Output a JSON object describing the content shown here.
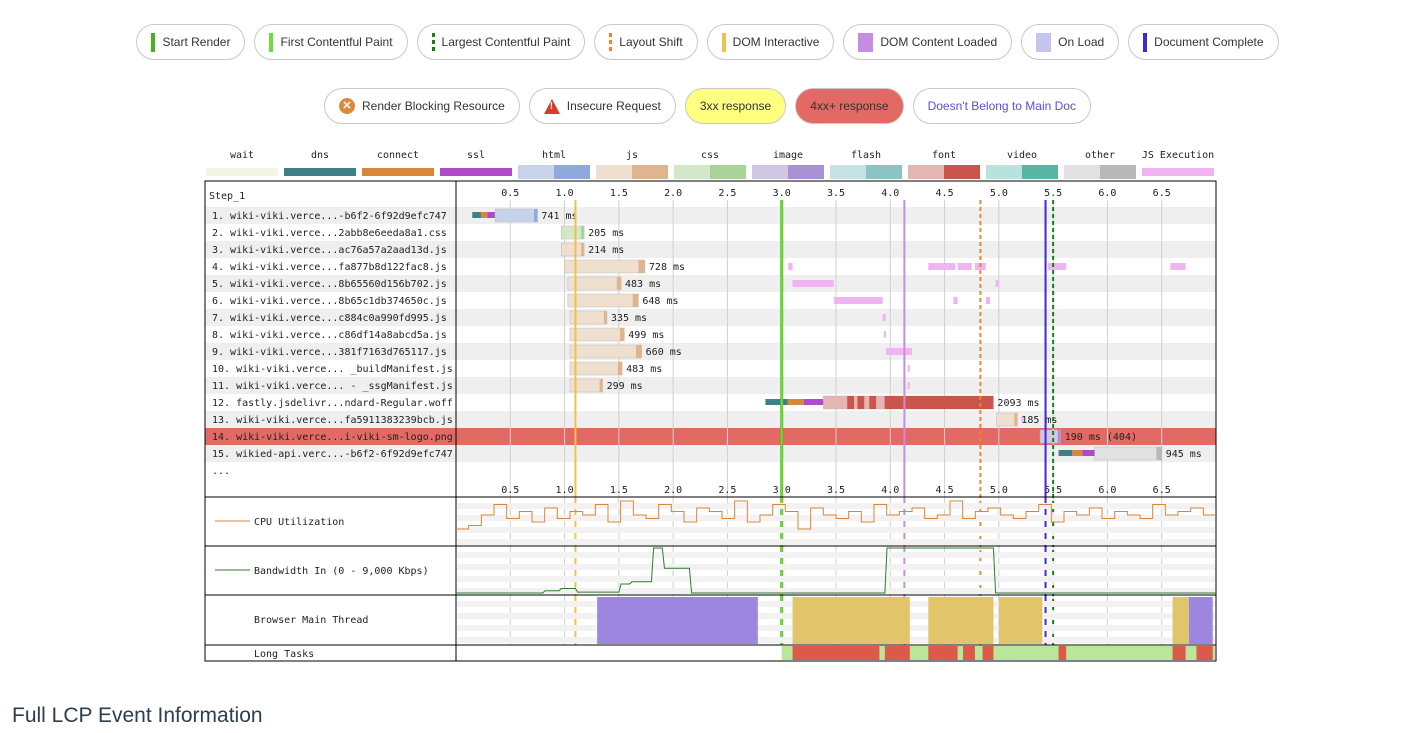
{
  "legend_top": [
    {
      "label": "Start Render",
      "kind": "bar",
      "color": "#4caf1f"
    },
    {
      "label": "First Contentful Paint",
      "kind": "bar",
      "color": "#6fdc3c"
    },
    {
      "label": "Largest Contentful Paint",
      "kind": "dash",
      "color": "#1b7d12"
    },
    {
      "label": "Layout Shift",
      "kind": "dash",
      "color": "#e38a2a"
    },
    {
      "label": "DOM Interactive",
      "kind": "bar",
      "color": "#f0c14b"
    },
    {
      "label": "DOM Content Loaded",
      "kind": "block",
      "color": "#c68ee0"
    },
    {
      "label": "On Load",
      "kind": "block",
      "color": "#c5c5f2"
    },
    {
      "label": "Document Complete",
      "kind": "bar",
      "color": "#3b2ad6"
    }
  ],
  "legend_bottom": [
    {
      "label": "Render Blocking Resource",
      "icon": "render-blocking-icon"
    },
    {
      "label": "Insecure Request",
      "icon": "warning-icon"
    },
    {
      "label": "3xx response",
      "style": "yellow"
    },
    {
      "label": "4xx+ response",
      "style": "red"
    },
    {
      "label": "Doesn't Belong to Main Doc",
      "style": "link"
    }
  ],
  "request_types": [
    {
      "label": "wait",
      "colors": [
        "#f5f5e6",
        "#f5f5e6"
      ]
    },
    {
      "label": "dns",
      "colors": [
        "#3f7f8a",
        "#3f7f8a"
      ]
    },
    {
      "label": "connect",
      "colors": [
        "#d7863a",
        "#d7863a"
      ]
    },
    {
      "label": "ssl",
      "colors": [
        "#b04bc7",
        "#b04bc7"
      ]
    },
    {
      "label": "html",
      "colors": [
        "#c7d3ea",
        "#8eaadc"
      ]
    },
    {
      "label": "js",
      "colors": [
        "#eedfcf",
        "#e0b58d"
      ]
    },
    {
      "label": "css",
      "colors": [
        "#d2e8c9",
        "#a8d49a"
      ]
    },
    {
      "label": "image",
      "colors": [
        "#cfc7e4",
        "#a991d6"
      ]
    },
    {
      "label": "flash",
      "colors": [
        "#c7e2e2",
        "#8cc3c3"
      ]
    },
    {
      "label": "font",
      "colors": [
        "#e3b6b1",
        "#c9554c"
      ]
    },
    {
      "label": "video",
      "colors": [
        "#b8e3dc",
        "#58b5a3"
      ]
    },
    {
      "label": "other",
      "colors": [
        "#e2e2e2",
        "#b8b8b8"
      ]
    },
    {
      "label": "JS Execution",
      "colors": [
        "#f1b4f2",
        "#f1b4f2"
      ]
    }
  ],
  "chart_data": {
    "type": "waterfall",
    "step_label": "Step_1",
    "x_unit": "seconds",
    "x_range": [
      0,
      7.0
    ],
    "ticks": [
      "0.5",
      "1.0",
      "1.5",
      "2.0",
      "2.5",
      "3.0",
      "3.5",
      "4.0",
      "4.5",
      "5.0",
      "5.5",
      "6.0",
      "6.5"
    ],
    "markers": [
      {
        "name": "DOM Interactive",
        "time": 1.1,
        "color": "#f0c14b",
        "style": "solid"
      },
      {
        "name": "Start Render",
        "time": 3.0,
        "color": "#4caf1f",
        "style": "solid"
      },
      {
        "name": "First Contentful Paint",
        "time": 3.0,
        "color": "#6fdc3c",
        "style": "solid"
      },
      {
        "name": "DOM Content Loaded",
        "time": 4.13,
        "color": "#c68ee0",
        "style": "solid"
      },
      {
        "name": "Layout Shift",
        "time": 4.83,
        "color": "#e38a2a",
        "style": "dashed"
      },
      {
        "name": "Document Complete",
        "time": 5.43,
        "color": "#3b2ad6",
        "style": "solid"
      },
      {
        "name": "Largest Contentful Paint",
        "time": 5.5,
        "color": "#1b7d12",
        "style": "dashed"
      }
    ],
    "requests": [
      {
        "num": "1.",
        "url": "wiki-viki.verce...-b6f2-6f92d9efc747",
        "type": "html",
        "start": 0.15,
        "end": 0.75,
        "label": "741 ms",
        "highlight": false,
        "js": []
      },
      {
        "num": "2.",
        "url": "wiki-viki.verce...2abb8e6eeda8a1.css",
        "type": "css",
        "start": 0.97,
        "end": 1.18,
        "label": "205 ms",
        "highlight": false,
        "js": []
      },
      {
        "num": "3.",
        "url": "wiki-viki.verce...ac76a57a2aad13d.js",
        "type": "js",
        "start": 0.97,
        "end": 1.18,
        "label": "214 ms",
        "highlight": false,
        "js": []
      },
      {
        "num": "4.",
        "url": "wiki-viki.verce...fa877b8d122fac8.js",
        "type": "js",
        "start": 1.0,
        "end": 1.74,
        "label": "728 ms",
        "highlight": false,
        "js": [
          [
            3.06,
            3.1
          ],
          [
            4.35,
            4.6
          ],
          [
            4.62,
            4.75
          ],
          [
            4.78,
            4.88
          ],
          [
            5.45,
            5.62
          ],
          [
            6.58,
            6.72
          ]
        ]
      },
      {
        "num": "5.",
        "url": "wiki-viki.verce...8b65560d156b702.js",
        "type": "js",
        "start": 1.03,
        "end": 1.52,
        "label": "483 ms",
        "highlight": false,
        "js": [
          [
            3.1,
            3.48
          ],
          [
            4.97,
            5.0
          ]
        ]
      },
      {
        "num": "6.",
        "url": "wiki-viki.verce...8b65c1db374650c.js",
        "type": "js",
        "start": 1.03,
        "end": 1.68,
        "label": "648 ms",
        "highlight": false,
        "js": [
          [
            3.48,
            3.93
          ],
          [
            4.58,
            4.62
          ],
          [
            4.88,
            4.92
          ]
        ]
      },
      {
        "num": "7.",
        "url": "wiki-viki.verce...c884c0a990fd995.js",
        "type": "js",
        "start": 1.05,
        "end": 1.39,
        "label": "335 ms",
        "highlight": false,
        "js": [
          [
            3.93,
            3.96
          ]
        ]
      },
      {
        "num": "8.",
        "url": "wiki-viki.verce...c86df14a8abcd5a.js",
        "type": "js",
        "start": 1.05,
        "end": 1.55,
        "label": "499 ms",
        "highlight": false,
        "js": [
          [
            3.94,
            3.96
          ]
        ]
      },
      {
        "num": "9.",
        "url": "wiki-viki.verce...381f7163d765117.js",
        "type": "js",
        "start": 1.05,
        "end": 1.71,
        "label": "660 ms",
        "highlight": false,
        "js": [
          [
            3.96,
            4.2
          ]
        ]
      },
      {
        "num": "10.",
        "url": "wiki-viki.verce... _buildManifest.js",
        "type": "js",
        "start": 1.05,
        "end": 1.53,
        "label": "483 ms",
        "highlight": false,
        "js": [
          [
            4.16,
            4.18
          ]
        ]
      },
      {
        "num": "11.",
        "url": "wiki-viki.verce... - _ssgManifest.js",
        "type": "js",
        "start": 1.05,
        "end": 1.35,
        "label": "299 ms",
        "highlight": false,
        "js": [
          [
            4.16,
            4.18
          ]
        ]
      },
      {
        "num": "12.",
        "url": "fastly.jsdelivr...ndard-Regular.woff",
        "type": "font",
        "start": 2.85,
        "end": 4.95,
        "label": "2093 ms",
        "highlight": false,
        "js": []
      },
      {
        "num": "13.",
        "url": "wiki-viki.verce...fa5911383239bcb.js",
        "type": "js",
        "start": 4.98,
        "end": 5.17,
        "label": "185 ms",
        "highlight": false,
        "js": [
          [
            5.21,
            5.23
          ]
        ]
      },
      {
        "num": "14.",
        "url": "wiki-viki.verce...i-viki-sm-logo.png",
        "type": "image",
        "start": 5.38,
        "end": 5.57,
        "label": "190 ms (404)",
        "highlight": true,
        "js": []
      },
      {
        "num": "15.",
        "url": "wikied-api.verc...-b6f2-6f92d9efc747",
        "type": "other",
        "start": 5.55,
        "end": 6.5,
        "label": "945 ms",
        "highlight": false,
        "js": []
      }
    ],
    "more_label": "...",
    "cpu_label": "CPU Utilization",
    "bandwidth_label": "Bandwidth In (0 - 9,000 Kbps)",
    "main_thread_label": "Browser Main Thread",
    "long_tasks_label": "Long Tasks",
    "cpu_series": [
      20,
      25,
      40,
      55,
      35,
      45,
      30,
      50,
      35,
      45,
      40,
      55,
      30,
      60,
      40,
      35,
      55,
      45,
      30,
      50,
      45,
      35,
      60,
      30,
      40,
      55,
      45,
      20,
      50,
      40,
      35,
      45,
      30,
      55,
      40,
      45,
      50,
      35,
      40,
      60,
      35,
      45,
      50,
      40,
      35,
      45,
      55,
      30,
      45,
      40,
      50,
      35,
      45,
      40,
      35,
      55,
      40,
      45,
      50,
      40
    ],
    "bandwidth_series": [
      [
        0,
        0
      ],
      [
        0.8,
        0
      ],
      [
        0.82,
        5
      ],
      [
        0.95,
        5
      ],
      [
        0.97,
        10
      ],
      [
        1.1,
        10
      ],
      [
        1.12,
        2
      ],
      [
        1.5,
        2
      ],
      [
        1.52,
        20
      ],
      [
        1.6,
        20
      ],
      [
        1.62,
        25
      ],
      [
        1.8,
        25
      ],
      [
        1.82,
        100
      ],
      [
        1.9,
        100
      ],
      [
        1.92,
        55
      ],
      [
        2.15,
        55
      ],
      [
        2.17,
        0
      ],
      [
        3.95,
        0
      ],
      [
        3.97,
        100
      ],
      [
        4.95,
        100
      ],
      [
        4.97,
        0
      ],
      [
        7.0,
        0
      ]
    ],
    "main_thread": [
      {
        "start": 1.3,
        "end": 2.78,
        "kind": "script"
      },
      {
        "start": 3.1,
        "end": 4.18,
        "kind": "layout"
      },
      {
        "start": 4.35,
        "end": 4.95,
        "kind": "layout"
      },
      {
        "start": 5.0,
        "end": 5.4,
        "kind": "layout"
      },
      {
        "start": 6.6,
        "end": 6.75,
        "kind": "layout"
      },
      {
        "start": 6.75,
        "end": 6.97,
        "kind": "script"
      }
    ],
    "long_tasks": [
      {
        "start": 3.1,
        "end": 3.9
      },
      {
        "start": 3.95,
        "end": 4.18
      },
      {
        "start": 4.35,
        "end": 4.62
      },
      {
        "start": 4.67,
        "end": 4.78
      },
      {
        "start": 4.85,
        "end": 4.95
      },
      {
        "start": 5.55,
        "end": 5.62
      },
      {
        "start": 6.6,
        "end": 6.72
      },
      {
        "start": 6.82,
        "end": 6.97
      }
    ]
  },
  "section_heading": "Full LCP Event Information"
}
